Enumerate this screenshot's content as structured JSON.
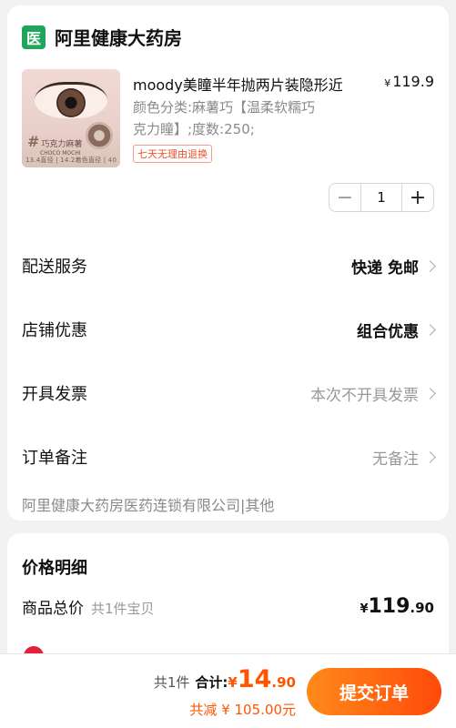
{
  "store": {
    "badge": "医",
    "name": "阿里健康大药房"
  },
  "product": {
    "title": "moody美瞳半年抛两片装隐形近",
    "price_currency": "¥",
    "price_value": "119.9",
    "spec_line1": "颜色分类:麻薯巧【温柔软糯巧",
    "spec_line2": "克力瞳】;度数:250;",
    "return_tag": "七天无理由退换",
    "image_label": "巧克力麻薯",
    "image_sub": "CHOCO MOCHI",
    "image_footer": "13.4直径 | 14.2着色直径 | 40%含水量 | 8.7基弧"
  },
  "quantity": {
    "minus": "−",
    "value": "1",
    "plus": "+"
  },
  "rows": {
    "delivery": {
      "label": "配送服务",
      "value": "快递 免邮"
    },
    "discount": {
      "label": "店铺优惠",
      "value": "组合优惠"
    },
    "invoice": {
      "label": "开具发票",
      "value": "本次不开具发票"
    },
    "note": {
      "label": "订单备注",
      "value": "无备注"
    }
  },
  "company": "阿里健康大药房医药连锁有限公司|其他",
  "price_detail": {
    "title": "价格明细",
    "goods_label": "商品总价",
    "goods_sub": "共1件宝贝",
    "currency": "¥",
    "goods_int": "119",
    "goods_dec": ".90"
  },
  "footer": {
    "count": "共1件",
    "total_label": "合计:",
    "total_currency": "¥",
    "total_int": "14",
    "total_dec": ".90",
    "saved": "共减 ¥ 105.00元",
    "submit": "提交订单"
  },
  "colors": {
    "accent": "#ff5500",
    "badge_green": "#1fa65a",
    "tag_red": "#e4532b"
  }
}
